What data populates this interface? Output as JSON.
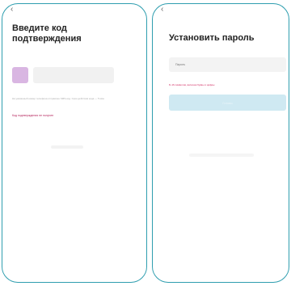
{
  "screen1": {
    "title": "Введите код подтверждения",
    "info_text": "На указанный номер телефона отправлен SMS-код. Срок действия кода — 5 мин",
    "resend_link": "Код подтверждения не получен"
  },
  "screen2": {
    "title": "Установить пароль",
    "password_placeholder": "Пароль",
    "password_hint": "8–16 символов, включая буквы и цифры",
    "submit_label": "Готово"
  },
  "colors": {
    "frame": "#2f9eaf",
    "accent_text": "#b5245c",
    "code_active": "#d9b6e2",
    "button_disabled": "#cfe9f2"
  }
}
